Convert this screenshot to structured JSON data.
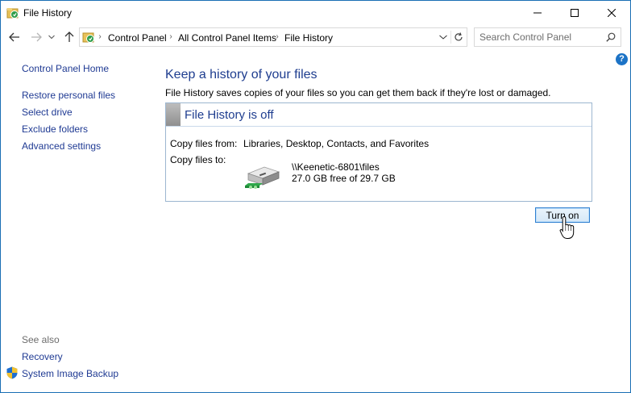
{
  "window": {
    "title": "File History",
    "buttons": {
      "minimize": "minimize",
      "maximize": "maximize",
      "close": "close"
    }
  },
  "nav": {
    "breadcrumbs": [
      "Control Panel",
      "All Control Panel Items",
      "File History"
    ],
    "search_placeholder": "Search Control Panel"
  },
  "left_pane": {
    "home": "Control Panel Home",
    "links": [
      "Restore personal files",
      "Select drive",
      "Exclude folders",
      "Advanced settings"
    ],
    "see_also_label": "See also",
    "see_also": [
      "Recovery",
      "System Image Backup"
    ]
  },
  "main": {
    "heading": "Keep a history of your files",
    "description": "File History saves copies of your files so you can get them back if they're lost or damaged.",
    "status_title": "File History is off",
    "copy_from_label": "Copy files from:",
    "copy_from_value": "Libraries, Desktop, Contacts, and Favorites",
    "copy_to_label": "Copy files to:",
    "drive_path": "\\\\Keenetic-6801\\files",
    "drive_space": "27.0 GB free of 29.7 GB",
    "turn_on_label": "Turn on"
  },
  "colors": {
    "heading": "#1e3d8f",
    "link": "#1f3a93",
    "accent": "#2f7fd0"
  }
}
